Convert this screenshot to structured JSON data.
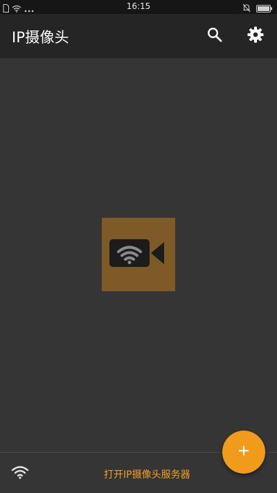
{
  "status_bar": {
    "time": "16:15",
    "icons_left": [
      "sim-icon",
      "wifi-icon",
      "more-dots-icon"
    ],
    "icons_right": [
      "notification-icon",
      "battery-icon"
    ]
  },
  "app_bar": {
    "title": "IP摄像头",
    "actions": [
      "search-icon",
      "settings-icon"
    ]
  },
  "main": {
    "logo": "camera-wifi-icon",
    "accent": "#f19b1a"
  },
  "bottom_bar": {
    "wifi_icon": "wifi-icon",
    "action_label": "打开IP摄像头服务器"
  },
  "fab": {
    "icon": "plus-icon"
  },
  "colors": {
    "background": "#353535",
    "app_bar": "#252525",
    "status_bar": "#161616",
    "accent": "#f19b1a",
    "logo_tile": "#7d5a26"
  }
}
